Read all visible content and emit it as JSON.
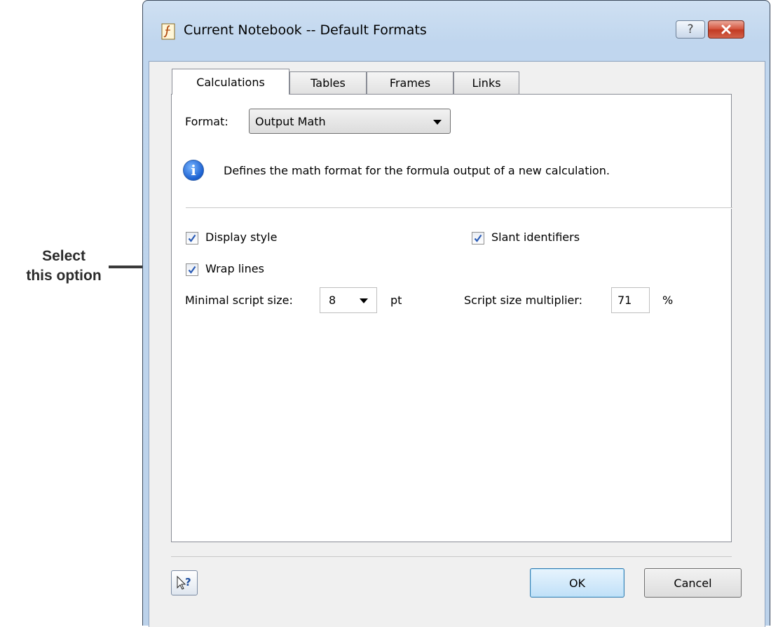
{
  "annotation": {
    "line1": "Select",
    "line2": "this option"
  },
  "window": {
    "title": "Current Notebook -- Default Formats",
    "help_glyph": "?"
  },
  "tabs": [
    {
      "label": "Calculations",
      "active": true
    },
    {
      "label": "Tables",
      "active": false
    },
    {
      "label": "Frames",
      "active": false
    },
    {
      "label": "Links",
      "active": false
    }
  ],
  "format": {
    "label": "Format:",
    "value": "Output Math"
  },
  "info": {
    "text": "Defines the math format for the formula output of a new calculation."
  },
  "options": {
    "display_style": {
      "label": "Display style",
      "checked": true
    },
    "slant_identifiers": {
      "label": "Slant identifiers",
      "checked": true
    },
    "wrap_lines": {
      "label": "Wrap lines",
      "checked": true
    }
  },
  "script_size": {
    "label": "Minimal script size:",
    "value": "8",
    "unit": "pt"
  },
  "multiplier": {
    "label": "Script size multiplier:",
    "value": "71",
    "unit": "%"
  },
  "buttons": {
    "ok": "OK",
    "cancel": "Cancel"
  },
  "colors": {
    "accent": "#3c7fb1",
    "close_red": "#c23a22",
    "check": "#2a5bb5"
  },
  "icons": [
    "app-icon",
    "help-icon",
    "close-icon",
    "info-icon",
    "check-icon",
    "dropdown-arrow-icon",
    "context-help-icon",
    "arrow-icon"
  ]
}
